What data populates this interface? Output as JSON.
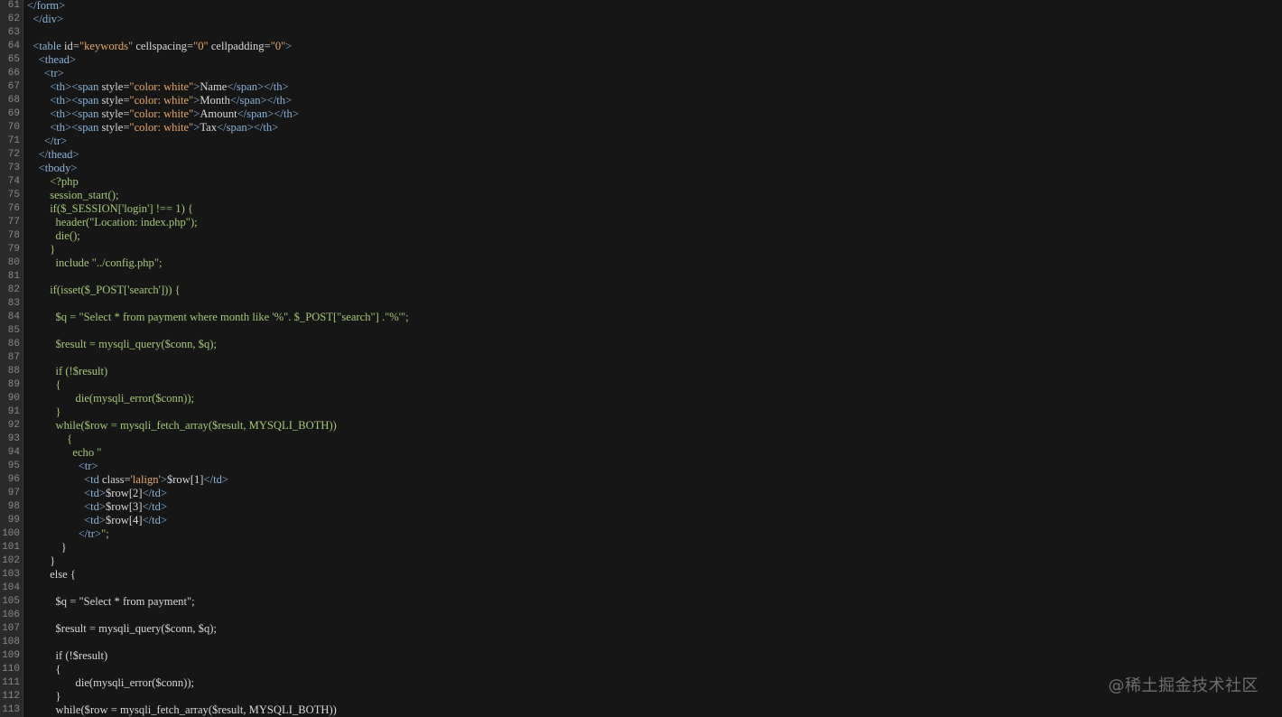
{
  "editor": {
    "lines": [
      {
        "n": "61",
        "segs": [
          {
            "c": "tag",
            "t": "</form>"
          }
        ]
      },
      {
        "n": "62",
        "segs": [
          {
            "c": "tag",
            "t": "  </div>"
          }
        ]
      },
      {
        "n": "63",
        "segs": []
      },
      {
        "n": "64",
        "segs": [
          {
            "c": "tag",
            "t": "  <table "
          },
          {
            "c": "attr",
            "t": "id="
          },
          {
            "c": "str",
            "t": "\"keywords\""
          },
          {
            "c": "attr",
            "t": " cellspacing="
          },
          {
            "c": "str",
            "t": "\"0\""
          },
          {
            "c": "attr",
            "t": " cellpadding="
          },
          {
            "c": "str",
            "t": "\"0\""
          },
          {
            "c": "tag",
            "t": ">"
          }
        ]
      },
      {
        "n": "65",
        "segs": [
          {
            "c": "tag",
            "t": "    <thead>"
          }
        ]
      },
      {
        "n": "66",
        "segs": [
          {
            "c": "tag",
            "t": "      <tr>"
          }
        ]
      },
      {
        "n": "67",
        "segs": [
          {
            "c": "tag",
            "t": "        <th><span "
          },
          {
            "c": "attr",
            "t": "style="
          },
          {
            "c": "str",
            "t": "\"color: white\""
          },
          {
            "c": "tag",
            "t": ">"
          },
          {
            "c": "plain",
            "t": "Name"
          },
          {
            "c": "tag",
            "t": "</span></th>"
          }
        ]
      },
      {
        "n": "68",
        "segs": [
          {
            "c": "tag",
            "t": "        <th><span "
          },
          {
            "c": "attr",
            "t": "style="
          },
          {
            "c": "str",
            "t": "\"color: white\""
          },
          {
            "c": "tag",
            "t": ">"
          },
          {
            "c": "plain",
            "t": "Month"
          },
          {
            "c": "tag",
            "t": "</span></th>"
          }
        ]
      },
      {
        "n": "69",
        "segs": [
          {
            "c": "tag",
            "t": "        <th><span "
          },
          {
            "c": "attr",
            "t": "style="
          },
          {
            "c": "str",
            "t": "\"color: white\""
          },
          {
            "c": "tag",
            "t": ">"
          },
          {
            "c": "plain",
            "t": "Amount"
          },
          {
            "c": "tag",
            "t": "</span></th>"
          }
        ]
      },
      {
        "n": "70",
        "segs": [
          {
            "c": "tag",
            "t": "        <th><span "
          },
          {
            "c": "attr",
            "t": "style="
          },
          {
            "c": "str",
            "t": "\"color: white\""
          },
          {
            "c": "tag",
            "t": ">"
          },
          {
            "c": "plain",
            "t": "Tax"
          },
          {
            "c": "tag",
            "t": "</span></th>"
          }
        ]
      },
      {
        "n": "71",
        "segs": [
          {
            "c": "tag",
            "t": "      </tr>"
          }
        ]
      },
      {
        "n": "72",
        "segs": [
          {
            "c": "tag",
            "t": "    </thead>"
          }
        ]
      },
      {
        "n": "73",
        "segs": [
          {
            "c": "tag",
            "t": "    <tbody>"
          }
        ]
      },
      {
        "n": "74",
        "segs": [
          {
            "c": "php",
            "t": "        <?php"
          }
        ]
      },
      {
        "n": "75",
        "segs": [
          {
            "c": "php",
            "t": "        session_start();"
          }
        ]
      },
      {
        "n": "76",
        "segs": [
          {
            "c": "php",
            "t": "        if($_SESSION['login'] !== 1) {"
          }
        ]
      },
      {
        "n": "77",
        "segs": [
          {
            "c": "php",
            "t": "          header(\"Location: index.php\");"
          }
        ]
      },
      {
        "n": "78",
        "segs": [
          {
            "c": "php",
            "t": "          die();"
          }
        ]
      },
      {
        "n": "79",
        "segs": [
          {
            "c": "php",
            "t": "        }"
          }
        ]
      },
      {
        "n": "80",
        "segs": [
          {
            "c": "php",
            "t": "          include \"../config.php\";"
          }
        ]
      },
      {
        "n": "81",
        "segs": []
      },
      {
        "n": "82",
        "segs": [
          {
            "c": "php",
            "t": "        if(isset($_POST['search'])) {"
          }
        ]
      },
      {
        "n": "83",
        "segs": []
      },
      {
        "n": "84",
        "segs": [
          {
            "c": "php",
            "t": "          $q = \"Select * from payment where month like '%\". $_POST[\"search\"] .\"%'\";"
          }
        ]
      },
      {
        "n": "85",
        "segs": []
      },
      {
        "n": "86",
        "segs": [
          {
            "c": "php",
            "t": "          $result = mysqli_query($conn, $q);"
          }
        ]
      },
      {
        "n": "87",
        "segs": []
      },
      {
        "n": "88",
        "segs": [
          {
            "c": "php",
            "t": "          if (!$result)"
          }
        ]
      },
      {
        "n": "89",
        "segs": [
          {
            "c": "php",
            "t": "          {"
          }
        ]
      },
      {
        "n": "90",
        "segs": [
          {
            "c": "php",
            "t": "                 die(mysqli_error($conn));"
          }
        ]
      },
      {
        "n": "91",
        "segs": [
          {
            "c": "php",
            "t": "          }"
          }
        ]
      },
      {
        "n": "92",
        "segs": [
          {
            "c": "php",
            "t": "          while($row = mysqli_fetch_array($result, MYSQLI_BOTH))"
          }
        ]
      },
      {
        "n": "93",
        "segs": [
          {
            "c": "php",
            "t": "              {"
          }
        ]
      },
      {
        "n": "94",
        "segs": [
          {
            "c": "php",
            "t": "                echo \""
          }
        ]
      },
      {
        "n": "95",
        "segs": [
          {
            "c": "tag",
            "t": "                  <tr>"
          }
        ]
      },
      {
        "n": "96",
        "segs": [
          {
            "c": "tag",
            "t": "                    <td "
          },
          {
            "c": "attr",
            "t": "class="
          },
          {
            "c": "str",
            "t": "'lalign'"
          },
          {
            "c": "tag",
            "t": ">"
          },
          {
            "c": "plain",
            "t": "$row[1]"
          },
          {
            "c": "tag",
            "t": "</td>"
          }
        ]
      },
      {
        "n": "97",
        "segs": [
          {
            "c": "tag",
            "t": "                    <td>"
          },
          {
            "c": "plain",
            "t": "$row[2]"
          },
          {
            "c": "tag",
            "t": "</td>"
          }
        ]
      },
      {
        "n": "98",
        "segs": [
          {
            "c": "tag",
            "t": "                    <td>"
          },
          {
            "c": "plain",
            "t": "$row[3]"
          },
          {
            "c": "tag",
            "t": "</td>"
          }
        ]
      },
      {
        "n": "99",
        "segs": [
          {
            "c": "tag",
            "t": "                    <td>"
          },
          {
            "c": "plain",
            "t": "$row[4]"
          },
          {
            "c": "tag",
            "t": "</td>"
          }
        ]
      },
      {
        "n": "100",
        "segs": [
          {
            "c": "tag",
            "t": "                  </tr>"
          },
          {
            "c": "php",
            "t": "\";"
          }
        ]
      },
      {
        "n": "101",
        "segs": [
          {
            "c": "plain",
            "t": "            }"
          }
        ]
      },
      {
        "n": "102",
        "segs": [
          {
            "c": "plain",
            "t": "        }"
          }
        ]
      },
      {
        "n": "103",
        "segs": [
          {
            "c": "plain",
            "t": "        else {"
          }
        ]
      },
      {
        "n": "104",
        "segs": []
      },
      {
        "n": "105",
        "segs": [
          {
            "c": "plain",
            "t": "          $q = \"Select * from payment\";"
          }
        ]
      },
      {
        "n": "106",
        "segs": []
      },
      {
        "n": "107",
        "segs": [
          {
            "c": "plain",
            "t": "          $result = mysqli_query($conn, $q);"
          }
        ]
      },
      {
        "n": "108",
        "segs": []
      },
      {
        "n": "109",
        "segs": [
          {
            "c": "plain",
            "t": "          if (!$result)"
          }
        ]
      },
      {
        "n": "110",
        "segs": [
          {
            "c": "plain",
            "t": "          {"
          }
        ]
      },
      {
        "n": "111",
        "segs": [
          {
            "c": "plain",
            "t": "                 die(mysqli_error($conn));"
          }
        ]
      },
      {
        "n": "112",
        "segs": [
          {
            "c": "plain",
            "t": "          }"
          }
        ]
      },
      {
        "n": "113",
        "segs": [
          {
            "c": "plain",
            "t": "          while($row = mysqli_fetch_array($result, MYSQLI_BOTH))"
          }
        ]
      }
    ]
  },
  "watermark": "@稀土掘金技术社区",
  "colors": {
    "background": "#161616",
    "gutter": "#2a2a2a",
    "line_number": "#8a8a8a",
    "html_tag": "#8ab4dc",
    "attribute": "#d7d7d7",
    "string": "#e8a86a",
    "php_code": "#a6c77a",
    "plain_text": "#d8d8d8"
  }
}
